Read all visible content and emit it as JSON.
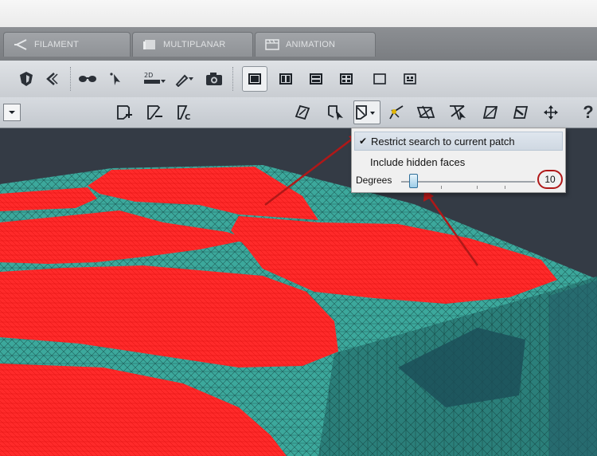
{
  "tabs": [
    {
      "label": "FILAMENT",
      "icon": "filament-icon"
    },
    {
      "label": "MULTIPLANAR",
      "icon": "multiplanar-icon"
    },
    {
      "label": "ANIMATION",
      "icon": "animation-icon"
    }
  ],
  "toolbar1": {
    "icons": [
      "shield-view-icon",
      "back-icon",
      "stereo-glasses-icon",
      "pointer-icon",
      "2d-ruler-icon",
      "brush-icon",
      "camera-icon"
    ],
    "layouts": [
      "layout-single-icon",
      "layout-two-columns-icon",
      "layout-two-rows-icon",
      "layout-quad-icon",
      "layout-empty-icon",
      "layout-compact-icon"
    ],
    "selected_layout": "layout-single-icon"
  },
  "toolbar2": {
    "patch_tools": [
      "add-patch-icon",
      "remove-patch-icon",
      "clear-patch-icon"
    ],
    "select_tools": [
      "lasso-select-icon",
      "pick-face-icon",
      "patch-select-icon",
      "brush-select-icon",
      "region-select-icon",
      "faces-select-icon",
      "plane-icon",
      "plane-select-icon",
      "move-icon",
      "help-icon"
    ],
    "help_label": "?"
  },
  "menu": {
    "restrict_label": "Restrict search to current patch",
    "restrict_checked": true,
    "hidden_label": "Include hidden faces",
    "degrees_label": "Degrees",
    "degrees_value": "10"
  },
  "colors": {
    "patch_red": "#ff2a2a",
    "mesh_teal": "#3ca89c",
    "viewport_bg": "#343b45",
    "annotation_red": "#b01818"
  }
}
